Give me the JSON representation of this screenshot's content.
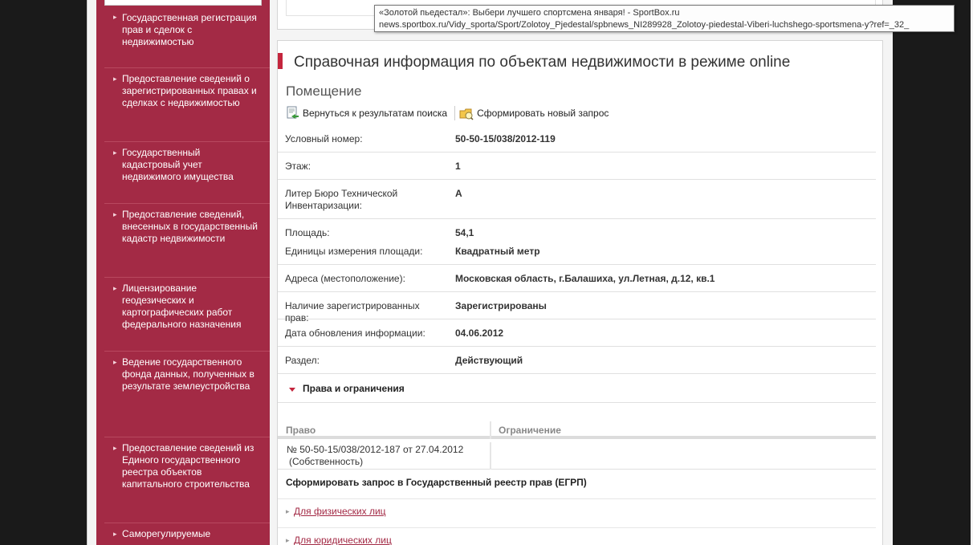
{
  "sidebar": {
    "items": [
      {
        "label": "Государственная регистрация прав и сделок с недвижимостью"
      },
      {
        "label": "Предоставление сведений о зарегистрированных правах и сделках с недвижимостью"
      },
      {
        "label": "Государственный кадастровый учет недвижимого имущества"
      },
      {
        "label": "Предоставление сведений, внесенных в государственный кадастр недвижимости"
      },
      {
        "label": "Лицензирование геодезических и картографических работ федерального назначения"
      },
      {
        "label": "Ведение государственного фонда данных, полученных в результате землеустройства"
      },
      {
        "label": "Предоставление сведений из Единого государственного реестра объектов капитального строительства"
      },
      {
        "label": "Саморегулируемые"
      }
    ]
  },
  "main": {
    "title": "Справочная информация по объектам недвижимости в режиме online",
    "subtitle": "Помещение",
    "toolbar": {
      "back_label": "Вернуться к результатам поиска",
      "new_request_label": "Сформировать новый запрос"
    },
    "fields": [
      {
        "label": "Условный номер:",
        "value": "50-50-15/038/2012-119"
      },
      {
        "label": "Этаж:",
        "value": "1"
      },
      {
        "label": "Литер Бюро Технической Инвентаризации:",
        "value": "А"
      },
      {
        "label": "Площадь:",
        "value": "54,1"
      },
      {
        "label": "Единицы измерения площади:",
        "value": "Квадратный метр"
      },
      {
        "label": "Адреса (местоположение):",
        "value": "Московская область, г.Балашиха, ул.Летная, д.12, кв.1"
      },
      {
        "label": "Наличие зарегистрированных прав:",
        "value": "Зарегистрированы"
      },
      {
        "label": "Дата обновления информации:",
        "value": "04.06.2012"
      },
      {
        "label": "Раздел:",
        "value": "Действующий"
      }
    ],
    "rights_section": {
      "title": "Права и ограничения",
      "col_right": "Право",
      "col_restriction": "Ограничение",
      "row_right_line1": "№ 50-50-15/038/2012-187  от 27.04.2012",
      "row_right_line2": "(Собственность)"
    },
    "egrp": {
      "title": "Сформировать запрос в Государственный реестр прав (ЕГРП)",
      "link_individuals": "Для физических лиц",
      "link_legal": "Для юридических лиц"
    }
  },
  "tooltip": {
    "line1": "«Золотой пьедестал»: Выбери лучшего спортсмена января! - SportBox.ru",
    "line2": "news.sportbox.ru/Vidy_sporta/Sport/Zolotoy_Pjedestal/spbnews_NI289928_Zolotoy-piedestal-Viberi-luchshego-sportsmena-y?ref=_32_"
  },
  "colors": {
    "sidebar_bg": "#a32a45",
    "accent": "#c4253d",
    "link": "#a32a45"
  }
}
